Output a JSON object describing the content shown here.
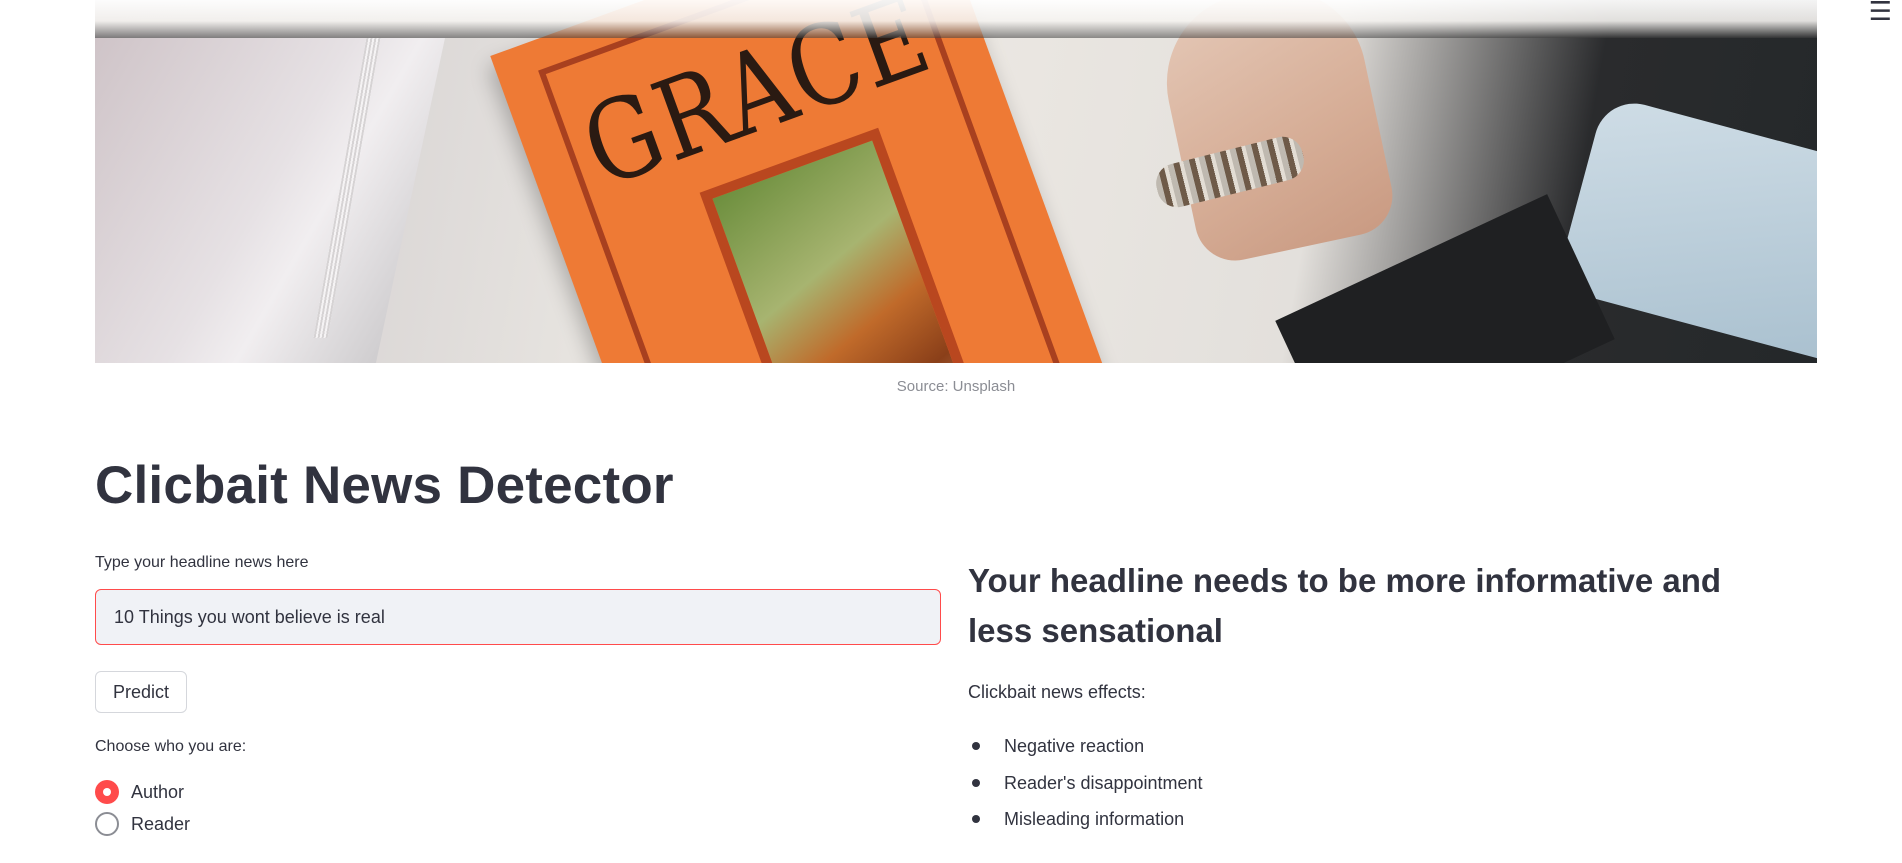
{
  "app": {
    "menu_icon": "hamburger-icon"
  },
  "hero": {
    "image_subject": "orange GRACE book on desk with wrist and bracelet",
    "book_title": "GRACE",
    "caption": "Source: Unsplash"
  },
  "main": {
    "title": "Clicbait News Detector",
    "input": {
      "label": "Type your headline news here",
      "value": "10 Things you wont believe is real"
    },
    "predict_button": "Predict",
    "role": {
      "label": "Choose who you are:",
      "options": [
        "Author",
        "Reader"
      ],
      "selected": "Author"
    }
  },
  "result": {
    "heading": "Your headline needs to be more informative and less sensational",
    "effects_label": "Clickbait news effects:",
    "effects": [
      "Negative reaction",
      "Reader's disappointment",
      "Misleading information"
    ]
  },
  "colors": {
    "accent": "#ff4b4b",
    "text": "#31333f",
    "input_bg": "#f0f2f6",
    "caption": "#8b8d94"
  }
}
